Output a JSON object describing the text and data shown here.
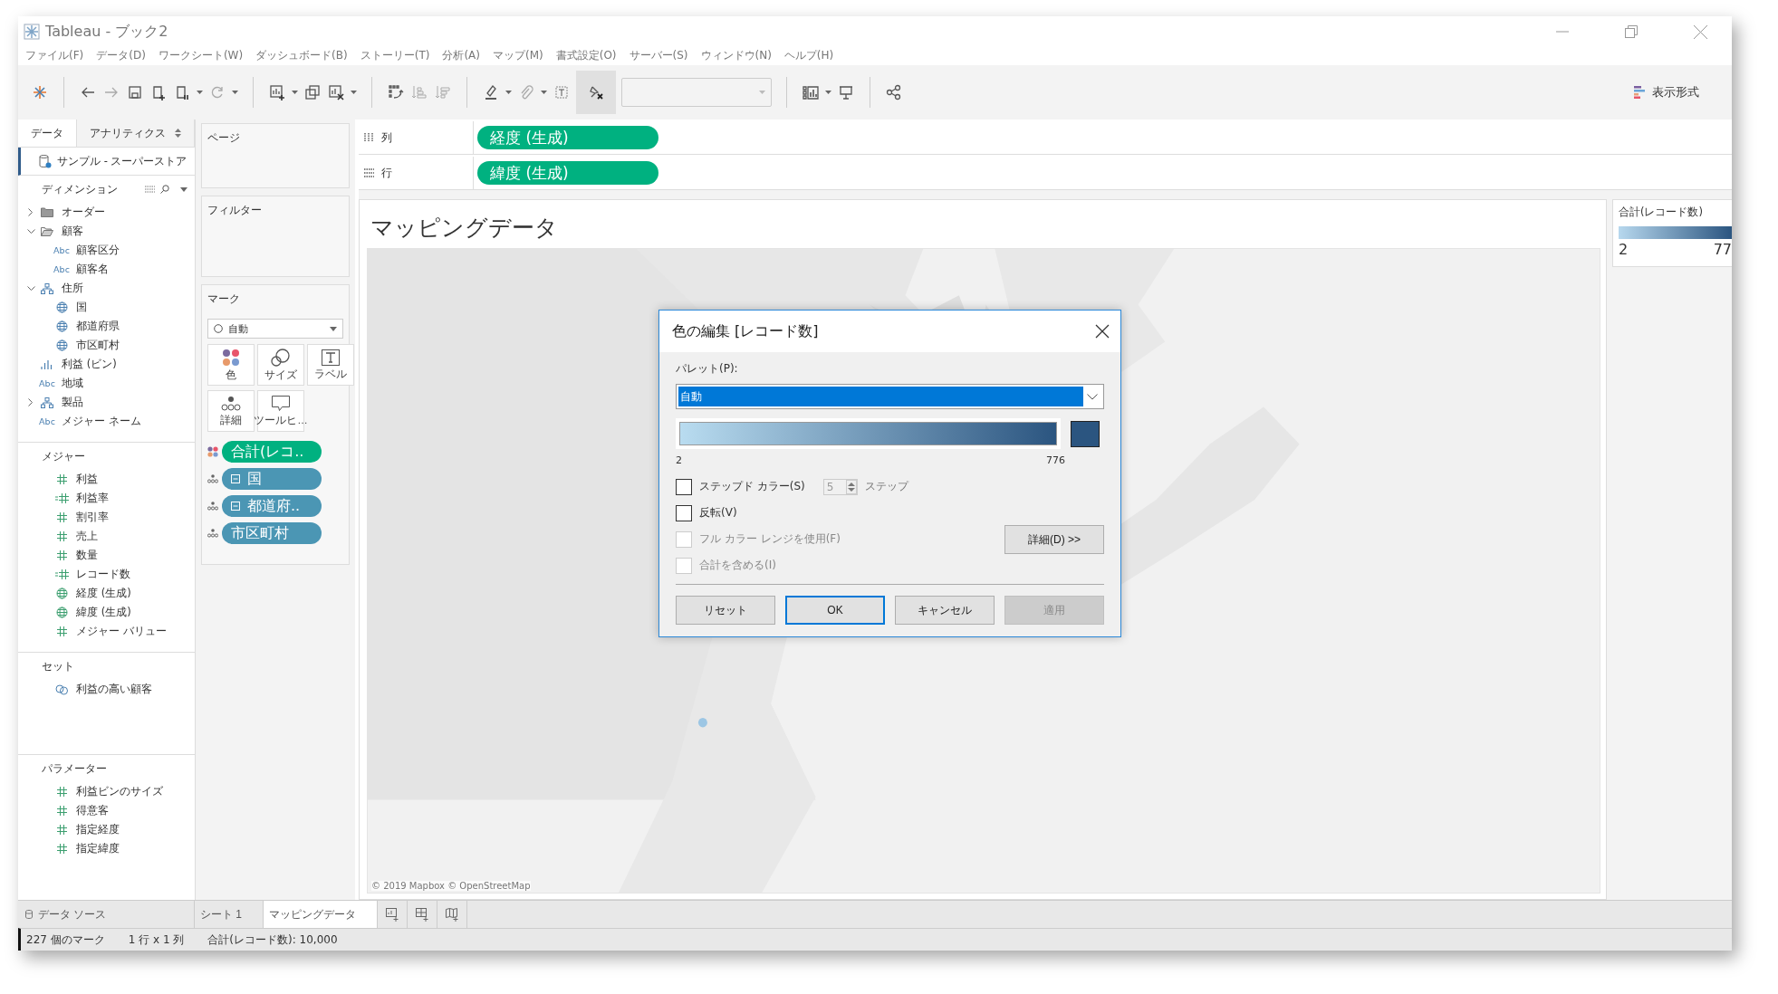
{
  "window": {
    "title": "Tableau - ブック2"
  },
  "menu": [
    "ファイル(F)",
    "データ(D)",
    "ワークシート(W)",
    "ダッシュボード(B)",
    "ストーリー(T)",
    "分析(A)",
    "マップ(M)",
    "書式設定(O)",
    "サーバー(S)",
    "ウィンドウ(N)",
    "ヘルプ(H)"
  ],
  "toolbar": {
    "show_me": "表示形式"
  },
  "data_pane": {
    "tabs": [
      {
        "label": "データ",
        "selected": true
      },
      {
        "label": "アナリティクス",
        "selected": false
      }
    ],
    "data_source": "サンプル - スーパーストア",
    "dimensions": {
      "title": "ディメンション",
      "items": [
        {
          "label": "オーダー",
          "kind": "folder",
          "expanded": false
        },
        {
          "label": "顧客",
          "kind": "folder",
          "expanded": true,
          "children": [
            {
              "label": "顧客区分",
              "kind": "string",
              "badge": "Abc"
            },
            {
              "label": "顧客名",
              "kind": "string",
              "badge": "Abc"
            }
          ]
        },
        {
          "label": "住所",
          "kind": "hierarchy",
          "expanded": true,
          "children": [
            {
              "label": "国",
              "kind": "geo"
            },
            {
              "label": "都道府県",
              "kind": "geo"
            },
            {
              "label": "市区町村",
              "kind": "geo"
            }
          ]
        },
        {
          "label": "利益 (ビン)",
          "kind": "bin"
        },
        {
          "label": "地域",
          "kind": "string",
          "badge": "Abc"
        },
        {
          "label": "製品",
          "kind": "hierarchy",
          "expanded": false
        },
        {
          "label": "メジャー ネーム",
          "kind": "string",
          "badge": "Abc"
        }
      ]
    },
    "measures": {
      "title": "メジャー",
      "items": [
        {
          "label": "利益",
          "kind": "number"
        },
        {
          "label": "利益率",
          "kind": "calc"
        },
        {
          "label": "割引率",
          "kind": "number"
        },
        {
          "label": "売上",
          "kind": "number"
        },
        {
          "label": "数量",
          "kind": "number"
        },
        {
          "label": "レコード数",
          "kind": "calc"
        },
        {
          "label": "経度 (生成)",
          "kind": "geo"
        },
        {
          "label": "緯度 (生成)",
          "kind": "geo"
        },
        {
          "label": "メジャー バリュー",
          "kind": "number"
        }
      ]
    },
    "sets": {
      "title": "セット",
      "items": [
        {
          "label": "利益の高い顧客",
          "kind": "set"
        }
      ]
    },
    "parameters": {
      "title": "パラメーター",
      "items": [
        {
          "label": "利益ビンのサイズ",
          "kind": "number"
        },
        {
          "label": "得意客",
          "kind": "number"
        },
        {
          "label": "指定経度",
          "kind": "number"
        },
        {
          "label": "指定緯度",
          "kind": "number"
        }
      ]
    }
  },
  "shelves": {
    "pages": "ページ",
    "filters": "フィルター",
    "marks": {
      "title": "マーク",
      "mark_type": "自動",
      "cards": [
        {
          "label": "色",
          "kind": "color"
        },
        {
          "label": "サイズ",
          "kind": "size"
        },
        {
          "label": "ラベル",
          "kind": "label"
        },
        {
          "label": "詳細",
          "kind": "detail"
        },
        {
          "label": "ツールヒ…",
          "kind": "tooltip"
        }
      ],
      "pills": [
        {
          "label": "合計(レコ..",
          "kind": "color",
          "color": "#00b180",
          "collapsible": false
        },
        {
          "label": "国",
          "kind": "detail",
          "color": "#4b96b4",
          "collapsible": true
        },
        {
          "label": "都道府..",
          "kind": "detail",
          "color": "#4b96b4",
          "collapsible": true
        },
        {
          "label": "市区町村",
          "kind": "detail",
          "color": "#4b96b4",
          "collapsible": false
        }
      ]
    }
  },
  "columns": {
    "label": "列",
    "pill": "経度 (生成)"
  },
  "rows": {
    "label": "行",
    "pill": "緯度 (生成)"
  },
  "view": {
    "title": "マッピングデータ",
    "attribution": "© 2019 Mapbox © OpenStreetMap"
  },
  "legend": {
    "title": "合計(レコード数)",
    "min": "2",
    "max": "77"
  },
  "dialog": {
    "title": "色の編集 [レコード数]",
    "palette_label": "パレット(P):",
    "palette": "自動",
    "min": "2",
    "max": "776",
    "options": [
      {
        "label": "ステップド カラー(S)",
        "kind": "stepped",
        "checked": false,
        "disabled": false,
        "steps": "5",
        "steps_unit": "ステップ"
      },
      {
        "label": "反転(V)",
        "kind": "plain",
        "checked": false,
        "disabled": false
      },
      {
        "label": "フル カラー レンジを使用(F)",
        "kind": "plain",
        "checked": false,
        "disabled": true
      },
      {
        "label": "合計を含める(I)",
        "kind": "plain",
        "checked": false,
        "disabled": true
      }
    ],
    "details_button": "詳細(D) >>",
    "buttons": [
      {
        "label": "リセット",
        "default": false,
        "disabled": false
      },
      {
        "label": "OK",
        "default": true,
        "disabled": false
      },
      {
        "label": "キャンセル",
        "default": false,
        "disabled": false
      },
      {
        "label": "適用",
        "default": false,
        "disabled": true
      }
    ]
  },
  "sheet_tabs": {
    "data_source": "データ ソース",
    "sheets": [
      {
        "label": "シート 1",
        "selected": false
      },
      {
        "label": "マッピングデータ",
        "selected": true
      }
    ]
  },
  "status_bar": [
    "227 個のマーク",
    "1 行 x 1 列",
    "合計(レコード数): 10,000"
  ]
}
